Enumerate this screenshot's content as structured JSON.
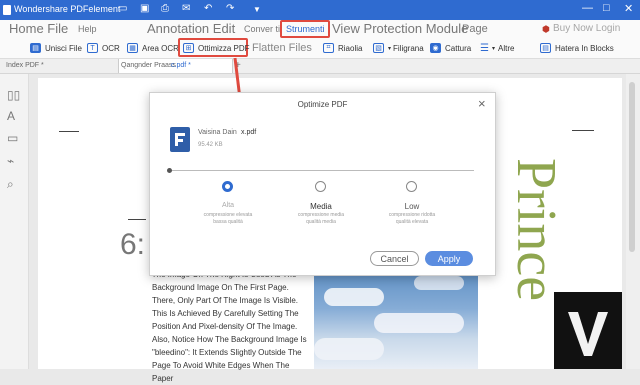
{
  "app": {
    "title": "Wondershare PDFelement"
  },
  "menubar": {
    "home": "Home File",
    "help": "Help",
    "annotation": "Annotation Edit",
    "convert": "Conver ti",
    "tools": "Strumenti",
    "view_protection": "View Protection Module",
    "page": "Page",
    "buy": "Buy Now Login"
  },
  "toolbar": {
    "merge": "Unisci File",
    "ocr": "OCR",
    "area_ocr": "Area OCR",
    "optimize": "Ottimizza PDF",
    "flatten": "Flatten Files",
    "crop": "Riaolia",
    "watermark": "Filigrana",
    "capture": "Cattura",
    "more": "Altre",
    "batch": "Hatera In Blocks"
  },
  "tabs": {
    "tab1": "Index PDF *",
    "tab2_prefix": "Qangnder Praass",
    "tab2_file": "c.pdf *",
    "add": "+"
  },
  "document": {
    "heading_fragment": "6:",
    "vertical_word": "Prince",
    "body_text": [
      "The Image On The Right Is Used As The",
      "Background Image On The First Page.",
      "There, Only Part Of The Image Is Visible.",
      "This Is Achieved By Carefully Setting The",
      "Position And Pixel-density Of The Image.",
      "Also, Notice How The Background Image Is",
      "\"bleedino\": It Extends Slightly Outside The",
      "Page To Avoid White Edges When The Paper"
    ]
  },
  "dialog": {
    "title": "Optimize PDF",
    "close": "×",
    "file_name": "Vaisina Dain",
    "file_ext": "x.pdf",
    "file_size": "95.42 KB",
    "options": [
      {
        "label": "Alta",
        "desc1": "compressione elevata",
        "desc2": "bassa qualità",
        "selected": true
      },
      {
        "label": "Media",
        "desc1": "compressione media",
        "desc2": "qualità media",
        "selected": false
      },
      {
        "label": "Low",
        "desc1": "compressione ridotta",
        "desc2": "qualità elevata",
        "selected": false
      }
    ],
    "cancel": "Cancel",
    "apply": "Apply"
  },
  "colors": {
    "titlebar": "#2f6bd0",
    "accent": "#2f6bd0",
    "highlight": "#e04a3f",
    "prince": "#8fa64f"
  }
}
